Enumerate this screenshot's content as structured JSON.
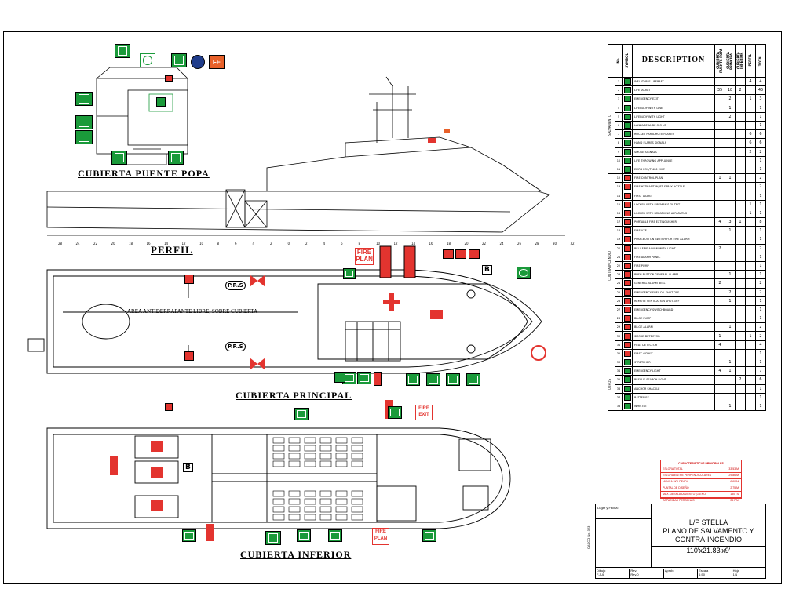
{
  "views": {
    "poop_deck": "CUBIERTA PUENTE POPA",
    "profile": "PERFIL",
    "main_deck": "CUBIERTA PRINCIPAL",
    "lower_deck": "CUBIERTA INFERIOR"
  },
  "main_deck_text": {
    "area": "AREA ANTIDERRAPANTE LIBRE, SOBRE CUBIERTA",
    "prs": "P.R.S",
    "fire_plan": "FIRE PLAN",
    "b_mark": "B"
  },
  "lower_deck_text": {
    "fire_exit": "FIRE EXIT",
    "fire_plan": "FIRE PLAN",
    "b_mark": "B"
  },
  "profile_text": {
    "ruler": [
      "28",
      "24",
      "22",
      "20",
      "18",
      "16",
      "14",
      "12",
      "10",
      "8",
      "6",
      "4",
      "2",
      "0",
      "2",
      "4",
      "6",
      "8",
      "10",
      "12",
      "14",
      "16",
      "18",
      "20",
      "22",
      "24",
      "26",
      "28",
      "30",
      "32"
    ]
  },
  "legend": {
    "header": {
      "no": "No.",
      "symbol": "SYMBOL",
      "description": "DESCRIPTION",
      "cols": [
        "CUBIERTA PUENTE POPA",
        "CUBIERTA PRINCIPAL",
        "CUBIERTA INFERIOR",
        "PERFIL",
        "TOTAL"
      ]
    },
    "groups": [
      "SALVAMENTO",
      "CONTRA INCENDIO",
      "OTROS"
    ],
    "rows": [
      {
        "n": "1",
        "d": "INFLATABLE LIFERAFT",
        "c": [
          "",
          "",
          "",
          "4",
          "4"
        ]
      },
      {
        "n": "2",
        "d": "LIFE JACKET",
        "c": [
          "35",
          "18",
          "2",
          "",
          "45"
        ]
      },
      {
        "n": "3",
        "d": "EMERGENCY EXIT",
        "c": [
          "",
          "2",
          "",
          "1",
          "3"
        ]
      },
      {
        "n": "4",
        "d": "LIFEBUOY WITH LINE",
        "c": [
          "",
          "1",
          "",
          "",
          "1"
        ]
      },
      {
        "n": "5",
        "d": "LIFEBUOY WITH LIGHT",
        "c": [
          "",
          "2",
          "",
          "",
          "1"
        ]
      },
      {
        "n": "6",
        "d": "LANZADERA DE OJO UP",
        "c": [
          "",
          "",
          "",
          "",
          "1"
        ]
      },
      {
        "n": "7",
        "d": "ROCKET PARACHUTE FLARES",
        "c": [
          "",
          "",
          "",
          "6",
          "6"
        ]
      },
      {
        "n": "8",
        "d": "HAND FLARES SIGNALS",
        "c": [
          "",
          "",
          "",
          "6",
          "6"
        ]
      },
      {
        "n": "9",
        "d": "SMOKE SIGNALS",
        "c": [
          "",
          "",
          "",
          "2",
          "2"
        ]
      },
      {
        "n": "10",
        "d": "LIFE THROWING APPLIANCE",
        "c": [
          "",
          "",
          "",
          "",
          "1"
        ]
      },
      {
        "n": "11",
        "d": "EPIRB POS/T 406 MHZ",
        "c": [
          "",
          "",
          "",
          "",
          "1"
        ]
      },
      {
        "n": "12",
        "d": "FIRE CONTROL PLAN",
        "c": [
          "1",
          "1",
          "",
          "",
          "2"
        ]
      },
      {
        "n": "13",
        "d": "FIRE HYDRANT W/JET-SPRAY NOZZLE",
        "c": [
          "",
          "",
          "",
          "",
          "2"
        ]
      },
      {
        "n": "14",
        "d": "FIRST AID KIT",
        "c": [
          "",
          "",
          "",
          "",
          "1"
        ]
      },
      {
        "n": "15",
        "d": "LOCKER WITH FIREMAN'S OUTFIT",
        "c": [
          "",
          "",
          "",
          "1",
          "1"
        ]
      },
      {
        "n": "16",
        "d": "LOCKER WITH BREATHING APPARATUS",
        "c": [
          "",
          "",
          "",
          "1",
          "1"
        ]
      },
      {
        "n": "17",
        "d": "PORTABLE FIRE EXTINGUISHER",
        "c": [
          "4",
          "3",
          "1",
          "",
          "8"
        ]
      },
      {
        "n": "18",
        "d": "FIRE AXE",
        "c": [
          "",
          "1",
          "",
          "",
          "1"
        ]
      },
      {
        "n": "19",
        "d": "PUSH-BUTTON SWITCH FOR FIRE ALARM",
        "c": [
          "",
          "",
          "",
          "",
          "1"
        ]
      },
      {
        "n": "20",
        "d": "BELL FIRE ALARM WITH LIGHT",
        "c": [
          "2",
          "",
          "",
          "",
          "2"
        ]
      },
      {
        "n": "21",
        "d": "FIRE ALARM PANEL",
        "c": [
          "",
          "",
          "",
          "",
          "1"
        ]
      },
      {
        "n": "22",
        "d": "FIRE PUMP",
        "c": [
          "",
          "",
          "",
          "",
          "1"
        ]
      },
      {
        "n": "23",
        "d": "PUSH BUTTON GENERAL ALARM",
        "c": [
          "",
          "1",
          "",
          "",
          "1"
        ]
      },
      {
        "n": "24",
        "d": "GENERAL ALARM BELL",
        "c": [
          "2",
          "",
          "",
          "",
          "2"
        ]
      },
      {
        "n": "25",
        "d": "EMERGENCY FUEL OIL SHUT-OFF",
        "c": [
          "",
          "2",
          "",
          "",
          "2"
        ]
      },
      {
        "n": "26",
        "d": "REMOTE VENTILATION SHUT-OFF",
        "c": [
          "",
          "1",
          "",
          "",
          "1"
        ]
      },
      {
        "n": "27",
        "d": "EMERGENCY SWITCHBOARD",
        "c": [
          "",
          "",
          "",
          "",
          "1"
        ]
      },
      {
        "n": "28",
        "d": "BILGE PUMP",
        "c": [
          "",
          "",
          "",
          "",
          "1"
        ]
      },
      {
        "n": "29",
        "d": "BILGE ALARM",
        "c": [
          "",
          "1",
          "",
          "",
          "2"
        ]
      },
      {
        "n": "30",
        "d": "SMOKE DETECTOR",
        "c": [
          "1",
          "",
          "",
          "1",
          "2"
        ]
      },
      {
        "n": "31",
        "d": "HEAT DETECTOR",
        "c": [
          "4",
          "",
          "",
          "",
          "4"
        ]
      },
      {
        "n": "32",
        "d": "FIRST AID KIT",
        "c": [
          "",
          "",
          "",
          "",
          "1"
        ]
      },
      {
        "n": "33",
        "d": "STRETCHER",
        "c": [
          "",
          "1",
          "",
          "",
          "1"
        ]
      },
      {
        "n": "34",
        "d": "EMERGENCY LIGHT",
        "c": [
          "4",
          "1",
          "",
          "",
          "7"
        ]
      },
      {
        "n": "35",
        "d": "RESCUE SEARCH LIGHT",
        "c": [
          "",
          "",
          "2",
          "",
          "6"
        ]
      },
      {
        "n": "36",
        "d": "ANCHOR SHACKLE",
        "c": [
          "",
          "",
          "",
          "",
          "1"
        ]
      },
      {
        "n": "37",
        "d": "BATTERIES",
        "c": [
          "",
          "",
          "",
          "",
          "1"
        ]
      },
      {
        "n": "38",
        "d": "WHISTLE",
        "c": [
          "",
          "1",
          "",
          "",
          "1"
        ]
      }
    ]
  },
  "characteristics": {
    "title": "CARACTERISTICAS PRINCIPALES",
    "rows": [
      {
        "k": "ESLORA TOTAL",
        "v": "33.53 M."
      },
      {
        "k": "ESLORA ENTRE PERPENDICULARES",
        "v": "29.86 M."
      },
      {
        "k": "MANGA MOLDEADA",
        "v": "6.60 M."
      },
      {
        "k": "PUNTAL DE DISEÑO",
        "v": "2.75 M."
      },
      {
        "k": "MAX. DESPLAZAMIENTO (LLENO)",
        "v": "150 TM"
      },
      {
        "k": "CAPACIDAD PERSONAS",
        "v": "25 PAX"
      }
    ]
  },
  "title_block": {
    "place_label": "Lugar y Fecha:",
    "title_line1": "L/P STELLA",
    "title_line2": "PLANO DE SALVAMENTO Y",
    "title_line3": "CONTRA-INCENDIO",
    "dimensions": "110'x21.83'x9'",
    "sheet_label": "CASCO No. 323",
    "footer": [
      "Dibujo",
      "Rev.",
      "Aprob.",
      "Escala",
      "Hoja"
    ],
    "footer_values": [
      "F.JUL",
      "Rev.0",
      "",
      "1:50",
      "1/1"
    ]
  },
  "colors": {
    "green": "#1a9a3a",
    "red": "#e3342f",
    "orange": "#e8612a"
  }
}
